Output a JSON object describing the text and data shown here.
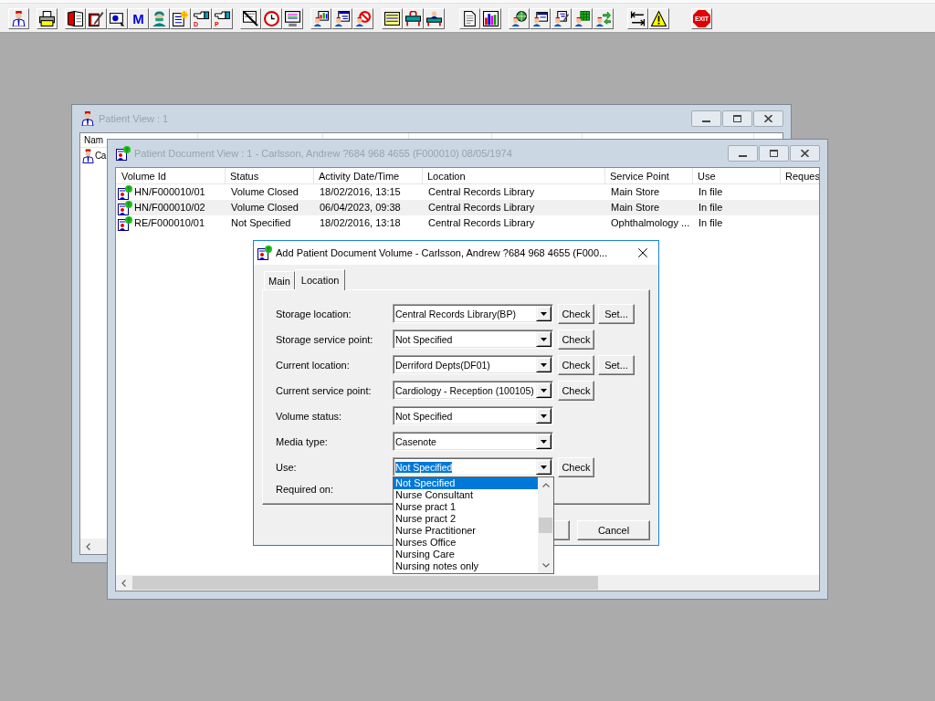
{
  "toolbar": {
    "letter_buttons": [
      "M",
      "D",
      "P"
    ],
    "exit_button": "EXIT"
  },
  "patient_view": {
    "title": "Patient View : 1",
    "active": false,
    "columns": [
      "Nam"
    ],
    "rows": [
      {
        "cells": [
          "Ca"
        ]
      }
    ]
  },
  "patient_document_view": {
    "title": "Patient Document View : 1 - Carlsson, Andrew ?684 968 4655 (F000010) 08/05/1974",
    "active": false,
    "columns": [
      "Volume Id",
      "Status",
      "Activity Date/Time",
      "Location",
      "Service Point",
      "Use",
      "Reques"
    ],
    "rows": [
      {
        "cells": [
          "HN/F000010/01",
          "Volume Closed",
          "18/02/2016, 13:15",
          "Central Records Library",
          "Main Store",
          "In file"
        ],
        "selected": false
      },
      {
        "cells": [
          "HN/F000010/02",
          "Volume Closed",
          "06/04/2023, 09:38",
          "Central Records Library",
          "Main Store",
          "In file"
        ],
        "selected": true
      },
      {
        "cells": [
          "RE/F000010/01",
          "Not Specified",
          "18/02/2016, 13:18",
          "Central Records Library",
          "Ophthalmology ...",
          "In file"
        ],
        "selected": false
      }
    ]
  },
  "add_volume_dialog": {
    "title": "Add Patient Document Volume - Carlsson, Andrew ?684 968 4655 (F000...",
    "active": true,
    "tabs": [
      {
        "label": "Main",
        "selected": false
      },
      {
        "label": "Location",
        "selected": true
      }
    ],
    "fields": [
      {
        "label": "Storage location:",
        "value": "Central Records Library(BP)",
        "buttons": [
          "Check",
          "Set..."
        ],
        "value_selected": false
      },
      {
        "label": "Storage service point:",
        "value": "Not Specified",
        "buttons": [
          "Check"
        ],
        "value_selected": false
      },
      {
        "label": "Current location:",
        "value": "Derriford Depts(DF01)",
        "buttons": [
          "Check",
          "Set..."
        ],
        "value_selected": false
      },
      {
        "label": "Current service point:",
        "value": "Cardiology - Reception (100105)",
        "buttons": [
          "Check"
        ],
        "value_selected": false
      },
      {
        "label": "Volume status:",
        "value": "Not Specified",
        "value_selected": false
      },
      {
        "label": "Media type:",
        "value": "Casenote",
        "value_selected": false
      },
      {
        "label": "Use:",
        "value": "Not Specified",
        "buttons": [
          "Check"
        ],
        "value_selected": true
      }
    ],
    "required_on_label": "Required on:",
    "dropdown_list": [
      {
        "label": "Not Specified",
        "selected": true
      },
      {
        "label": "Nurse Consultant",
        "selected": false
      },
      {
        "label": "Nurse pract 1",
        "selected": false
      },
      {
        "label": "Nurse pract 2",
        "selected": false
      },
      {
        "label": "Nurse Practitioner",
        "selected": false
      },
      {
        "label": "Nurses Office",
        "selected": false
      },
      {
        "label": "Nursing Care",
        "selected": false
      },
      {
        "label": "Nursing notes only",
        "selected": false
      }
    ],
    "buttons": [
      "Cancel"
    ]
  }
}
